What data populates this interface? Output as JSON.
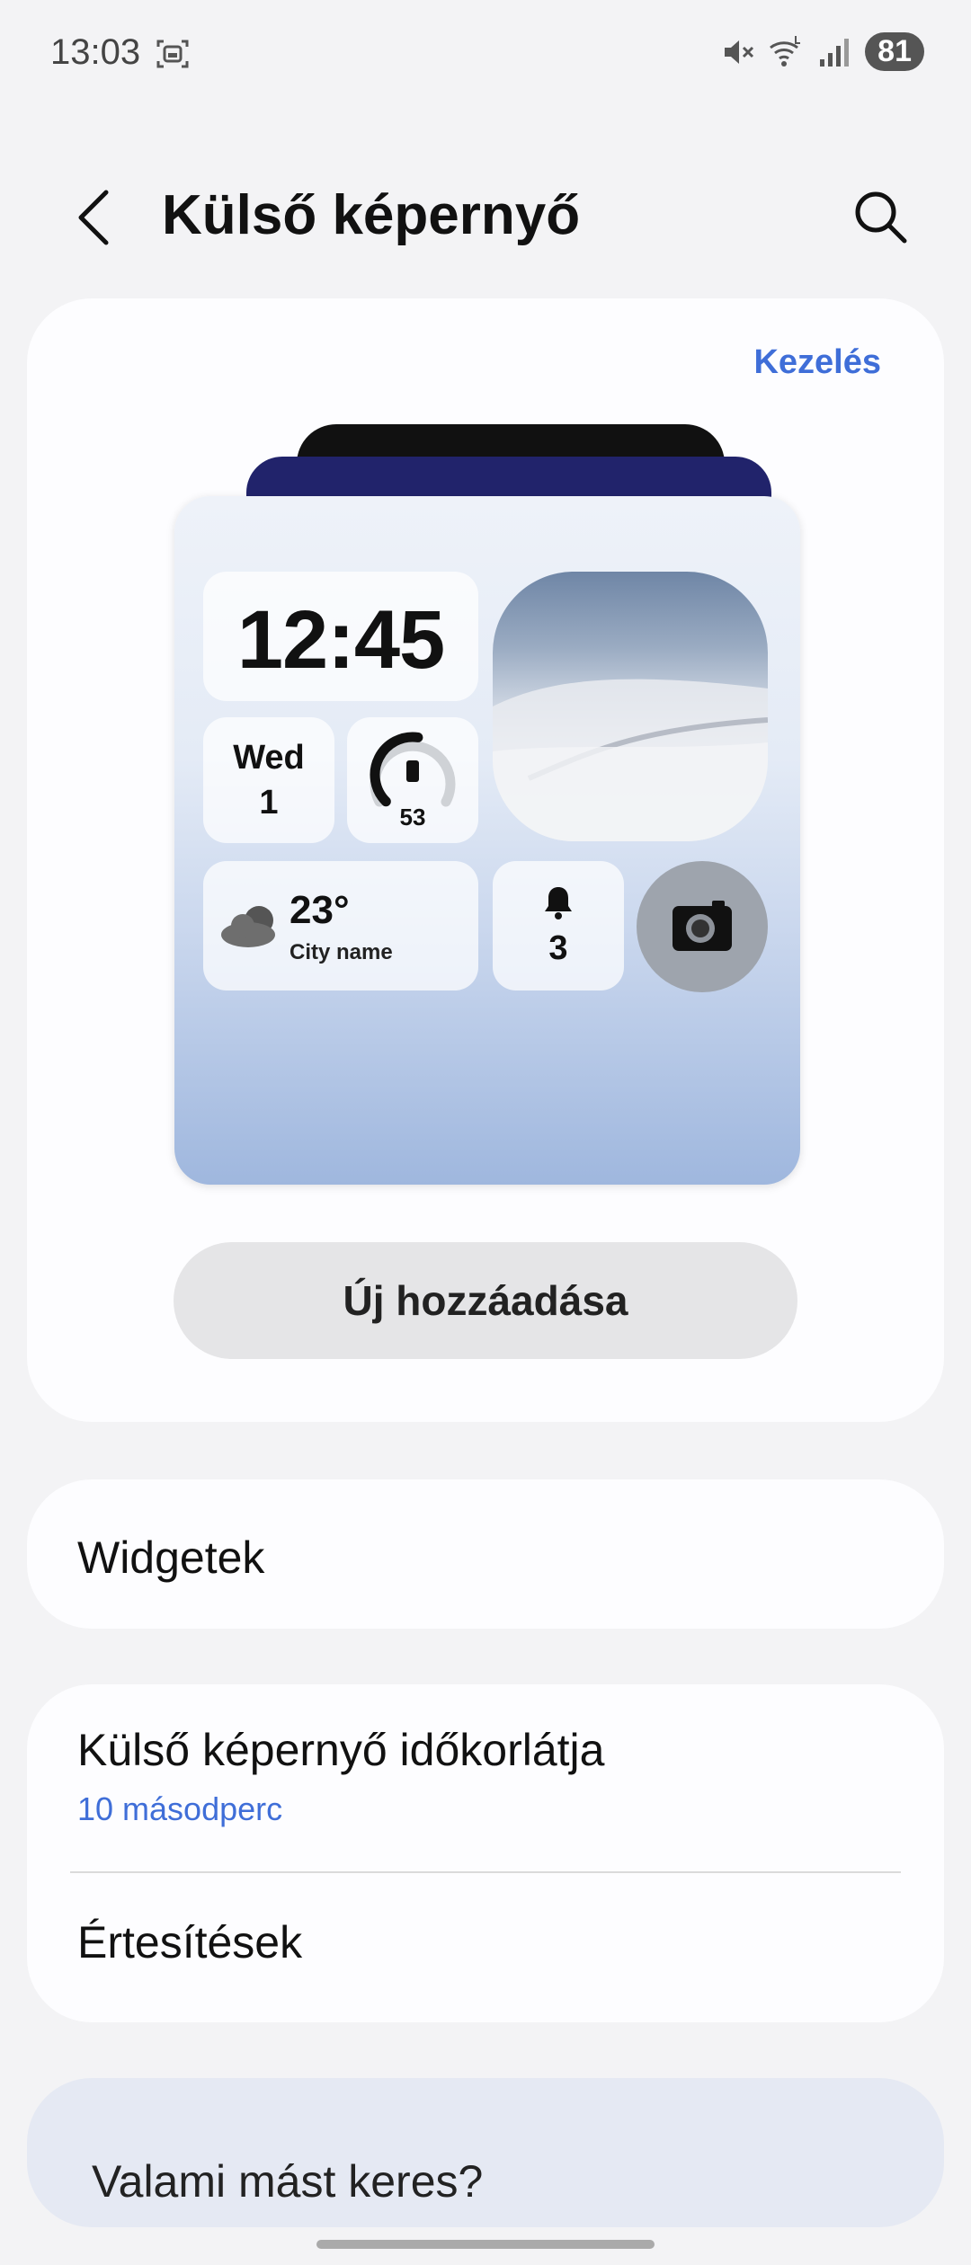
{
  "status_bar": {
    "time": "13:03",
    "battery": "81",
    "icons": [
      "screenshot-icon",
      "mute-icon",
      "wifi-icon",
      "signal-icon"
    ]
  },
  "header": {
    "title": "Külső képernyő",
    "back_icon": "chevron-left-icon",
    "search_icon": "search-icon"
  },
  "preview_card": {
    "manage_label": "Kezelés",
    "cover_screen": {
      "clock": "12:45",
      "date_day": "Wed",
      "date_num": "1",
      "battery_value": "53",
      "battery_level": 0.53,
      "weather_temp": "23°",
      "weather_city": "City name",
      "notification_count": "3"
    },
    "add_button_label": "Új hozzáadása"
  },
  "widgets_row": {
    "label": "Widgetek"
  },
  "settings": {
    "timeout_label": "Külső képernyő időkorlátja",
    "timeout_value": "10 másodperc",
    "notifications_label": "Értesítések"
  },
  "search_card": {
    "label": "Valami mást keres?"
  },
  "colors": {
    "accent": "#3f6ed8",
    "background": "#f3f3f5",
    "card": "#fdfdff",
    "search_card": "#e5e9f3",
    "phone_case_blue": "#21236b"
  }
}
